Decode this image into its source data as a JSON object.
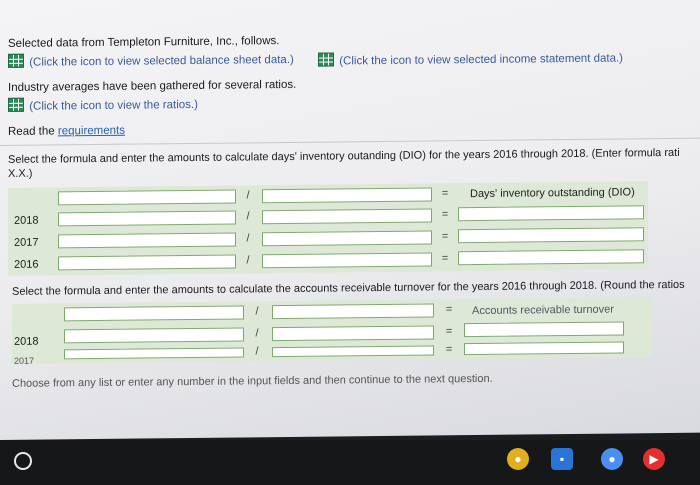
{
  "intro": {
    "selected_data": "Selected data from Templeton Furniture, Inc., follows.",
    "balance_sheet_link": "(Click the icon to view selected balance sheet data.)",
    "income_statement_link": "(Click the icon to view selected income statement data.)",
    "industry_averages": "Industry averages have been gathered for several ratios.",
    "ratios_link": "(Click the icon to view the ratios.)",
    "read_prefix": "Read the ",
    "requirements_link": "requirements"
  },
  "dio_section": {
    "instruction": "Select the formula and enter the amounts to calculate days' inventory outanding (DIO) for the years 2016 through 2018. (Enter formula rati",
    "instruction_cont": "X.X.)",
    "result_header": "Days' inventory outstanding (DIO)",
    "rows": [
      {
        "year": "2018"
      },
      {
        "year": "2017"
      },
      {
        "year": "2016"
      }
    ],
    "divide_symbol": "/",
    "equals_symbol": "="
  },
  "ar_section": {
    "instruction": "Select the formula and enter the amounts to calculate the accounts receivable turnover for the years 2016 through 2018. (Round the ratios",
    "result_header": "Accounts receivable turnover",
    "rows": [
      {
        "year": "2018"
      },
      {
        "year": "2017"
      }
    ],
    "divide_symbol": "/",
    "equals_symbol": "="
  },
  "footer_hint": "Choose from any list or enter any number in the input fields and then continue to the next question.",
  "shelf": {
    "apps": [
      {
        "icon": "chrome-icon",
        "color": "#e0b020"
      },
      {
        "icon": "files-icon",
        "color": "#2a74d8"
      },
      {
        "icon": "docs-icon",
        "color": "#4a8ef0"
      },
      {
        "icon": "youtube-icon",
        "color": "#e03030"
      }
    ]
  }
}
